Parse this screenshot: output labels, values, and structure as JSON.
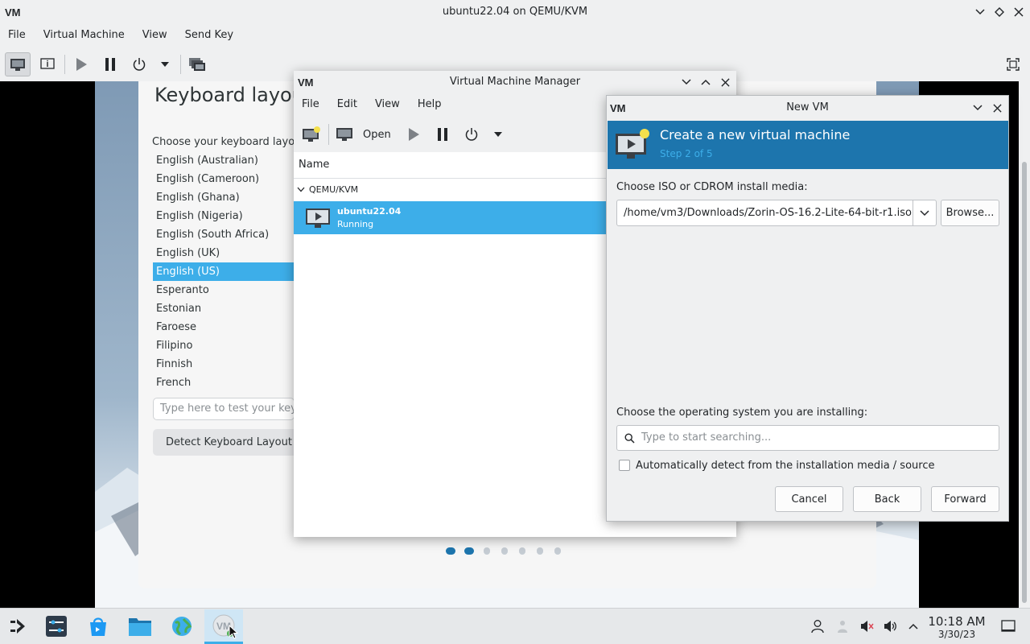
{
  "window": {
    "title": "ubuntu22.04 on QEMU/KVM",
    "menu": [
      "File",
      "Virtual Machine",
      "View",
      "Send Key"
    ]
  },
  "guest": {
    "title": "Keyboard layout",
    "prompt": "Choose your keyboard layout",
    "layouts": [
      "English (Australian)",
      "English (Cameroon)",
      "English (Ghana)",
      "English (Nigeria)",
      "English (South Africa)",
      "English (UK)",
      "English (US)",
      "Esperanto",
      "Estonian",
      "Faroese",
      "Filipino",
      "Finnish",
      "French"
    ],
    "selected_layout": "English (US)",
    "test_placeholder": "Type here to test your keyboard",
    "detect_button": "Detect Keyboard Layout"
  },
  "vmm": {
    "title": "Virtual Machine Manager",
    "menu": [
      "File",
      "Edit",
      "View",
      "Help"
    ],
    "toolbar_open": "Open",
    "column_name": "Name",
    "group": "QEMU/KVM",
    "vm_name": "ubuntu22.04",
    "vm_status": "Running"
  },
  "newvm": {
    "title": "New VM",
    "heading": "Create a new virtual machine",
    "step": "Step 2 of 5",
    "media_label": "Choose ISO or CDROM install media:",
    "media_value": "/home/vm3/Downloads/Zorin-OS-16.2-Lite-64-bit-r1.iso",
    "browse": "Browse...",
    "os_label": "Choose the operating system you are installing:",
    "os_placeholder": "Type to start searching...",
    "auto_detect": "Automatically detect from the installation media / source",
    "cancel": "Cancel",
    "back": "Back",
    "forward": "Forward"
  },
  "taskbar": {
    "time": "10:18 AM",
    "date": "3/30/23"
  },
  "colors": {
    "accent": "#3daee9",
    "banner": "#1d75ad",
    "step_text": "#3daee9"
  }
}
